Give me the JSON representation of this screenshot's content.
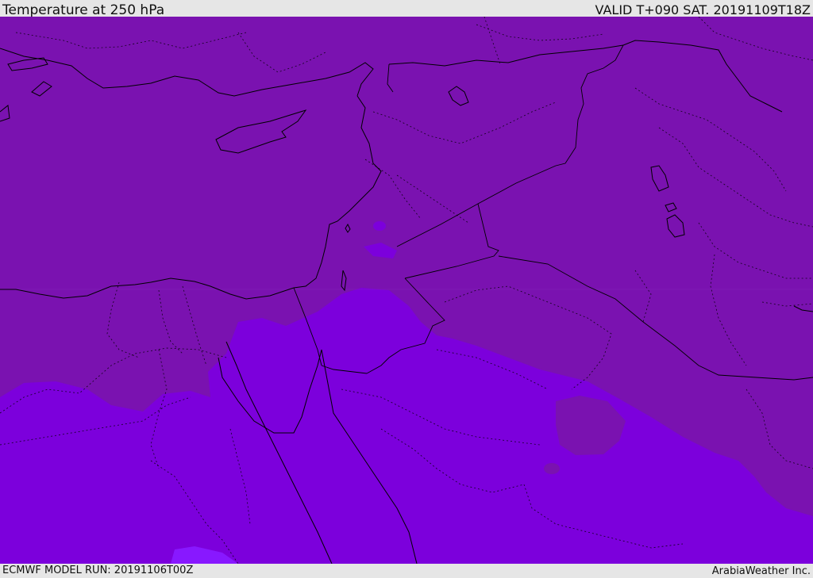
{
  "header": {
    "title": "Temperature at 250 hPa",
    "valid": "VALID T+090 SAT. 20191109T18Z"
  },
  "footer": {
    "model_run": "ECMWF MODEL RUN: 20191106T00Z",
    "credit": "ArabiaWeather Inc."
  },
  "map": {
    "colors": {
      "warm_region": "#7a12b0",
      "cold_region": "#7c00dc",
      "coldest_region": "#8818ff",
      "coastline": "#000000",
      "border": "#000000"
    }
  }
}
